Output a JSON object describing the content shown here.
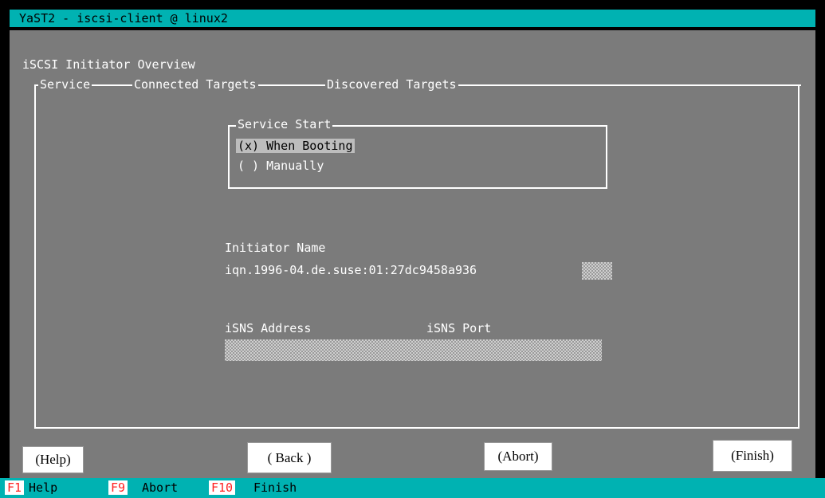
{
  "window": {
    "title": "YaST2 - iscsi-client @ linux2"
  },
  "dialog": {
    "heading": "iSCSI Initiator Overview"
  },
  "tabs": [
    {
      "label": "Service"
    },
    {
      "label": "Connected Targets"
    },
    {
      "label": "Discovered Targets"
    }
  ],
  "service_start": {
    "title": "Service Start",
    "options": [
      {
        "label": "(x) When Booting",
        "selected": true
      },
      {
        "label": "( ) Manually",
        "selected": false
      }
    ]
  },
  "initiator": {
    "label": "Initiator Name",
    "value": "iqn.1996-04.de.suse:01:27dc9458a936"
  },
  "isns": {
    "address_label": "iSNS Address",
    "port_label": "iSNS Port",
    "address_value": "",
    "port_value": ""
  },
  "buttons": {
    "help": "(Help)",
    "back": "( Back )",
    "abort": "(Abort)",
    "finish": "(Finish)"
  },
  "fkeys": [
    {
      "key": "F1",
      "label": "Help"
    },
    {
      "key": "F9",
      "label": "Abort"
    },
    {
      "key": "F10",
      "label": "Finish"
    }
  ],
  "colors": {
    "background": "#7b7b7b",
    "titlebar": "#00b2b2",
    "fkey_text": "#ff2020"
  }
}
